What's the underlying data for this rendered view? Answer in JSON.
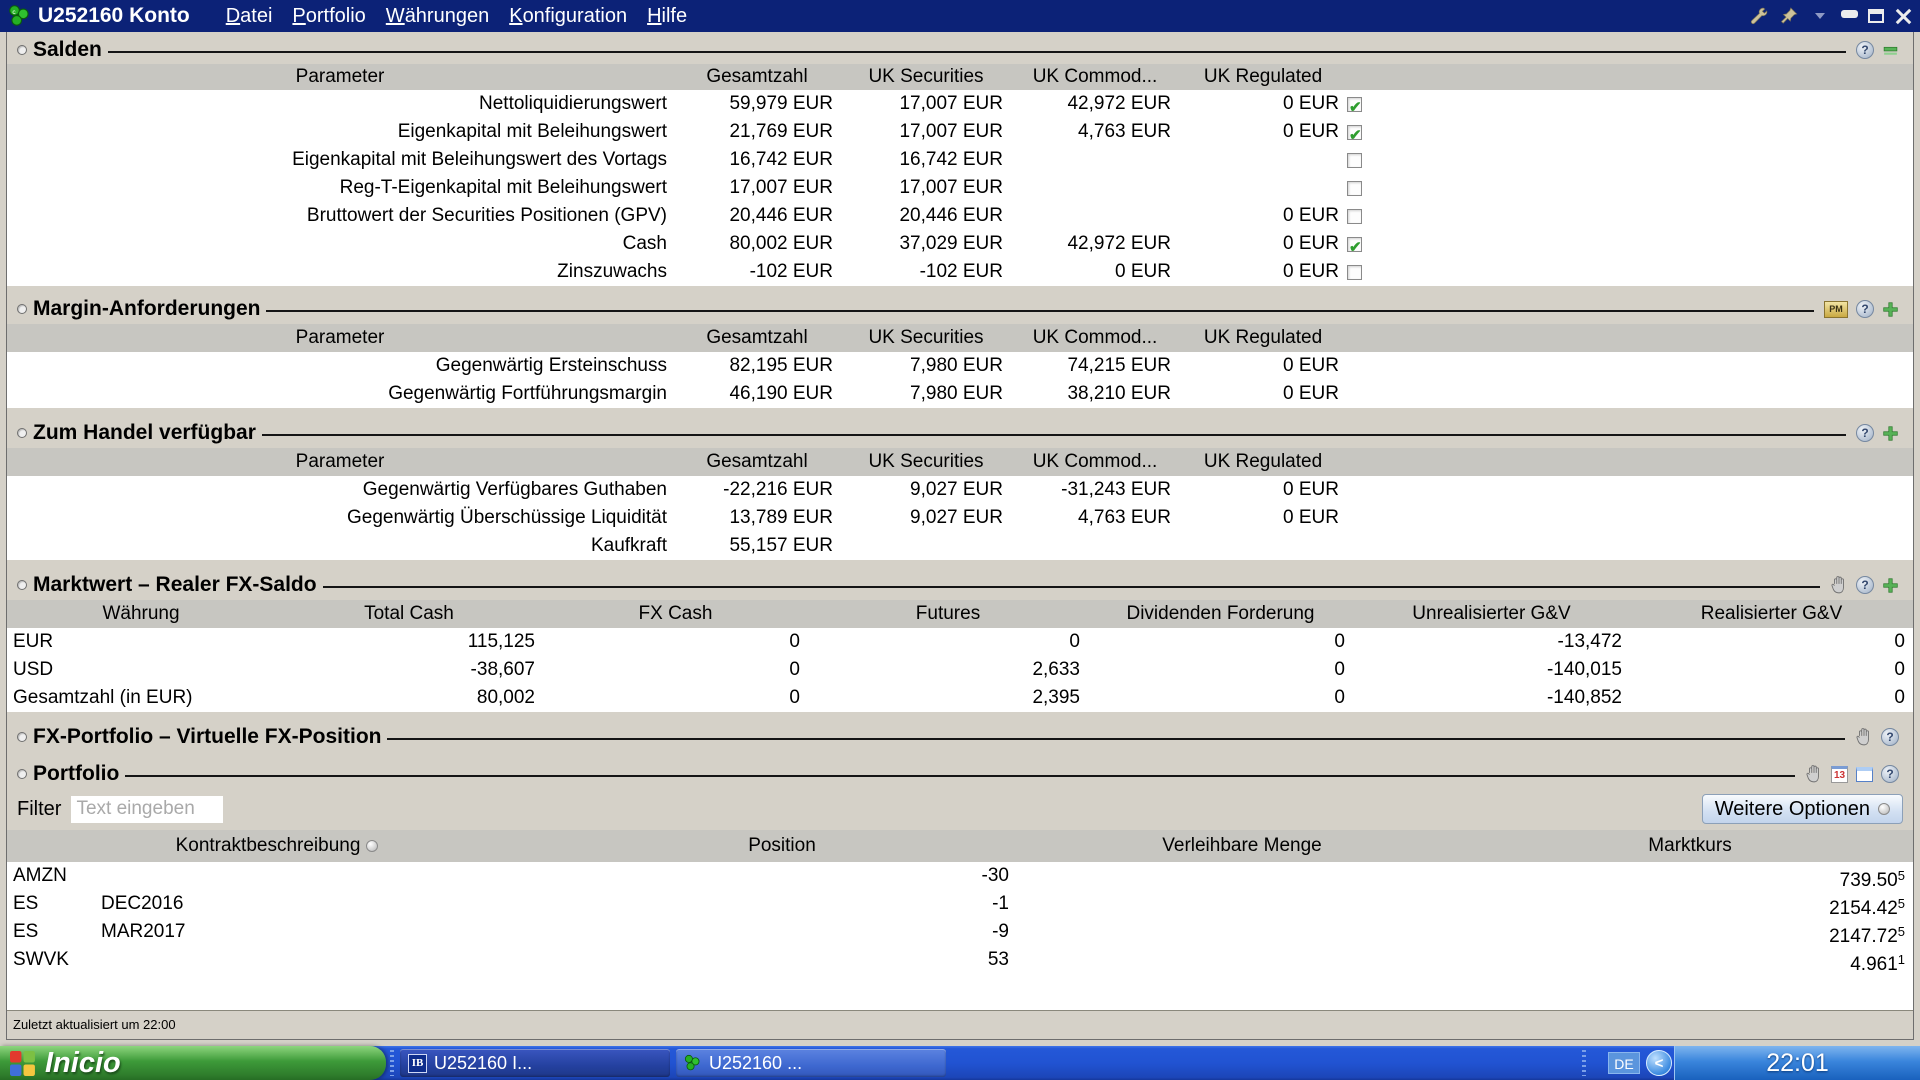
{
  "titlebar": {
    "title": "U252160 Konto",
    "menus": [
      {
        "label": "Datei"
      },
      {
        "label": "Portfolio"
      },
      {
        "label": "Währungen"
      },
      {
        "label": "Konfiguration"
      },
      {
        "label": "Hilfe"
      }
    ]
  },
  "balance_columns": {
    "parameter": "Parameter",
    "total": "Gesamtzahl",
    "uk_securities": "UK Securities",
    "uk_commodities": "UK Commod...",
    "uk_regulated": "UK Regulated"
  },
  "salden": {
    "title": "Salden",
    "rows": [
      {
        "label": "Nettoliquidierungswert",
        "total": "59,979 EUR",
        "uk_securities": "17,007 EUR",
        "uk_commodities": "42,972 EUR",
        "uk_regulated": "0 EUR",
        "checked": "true"
      },
      {
        "label": "Eigenkapital mit Beleihungswert",
        "total": "21,769 EUR",
        "uk_securities": "17,007 EUR",
        "uk_commodities": "4,763 EUR",
        "uk_regulated": "0 EUR",
        "checked": "true"
      },
      {
        "label": "Eigenkapital mit Beleihungswert des Vortags",
        "total": "16,742 EUR",
        "uk_securities": "16,742 EUR",
        "uk_commodities": "",
        "uk_regulated": "",
        "checked": "false"
      },
      {
        "label": "Reg-T-Eigenkapital mit Beleihungswert",
        "total": "17,007 EUR",
        "uk_securities": "17,007 EUR",
        "uk_commodities": "",
        "uk_regulated": "",
        "checked": "false"
      },
      {
        "label": "Bruttowert der Securities Positionen (GPV)",
        "total": "20,446 EUR",
        "uk_securities": "20,446 EUR",
        "uk_commodities": "",
        "uk_regulated": "0 EUR",
        "checked": "false"
      },
      {
        "label": "Cash",
        "total": "80,002 EUR",
        "uk_securities": "37,029 EUR",
        "uk_commodities": "42,972 EUR",
        "uk_regulated": "0 EUR",
        "checked": "true"
      },
      {
        "label": "Zinszuwachs",
        "total": "-102 EUR",
        "uk_securities": "-102 EUR",
        "uk_commodities": "0 EUR",
        "uk_regulated": "0 EUR",
        "checked": "false"
      }
    ]
  },
  "margin": {
    "title": "Margin-Anforderungen",
    "rows": [
      {
        "label": "Gegenwärtig Ersteinschuss",
        "total": "82,195 EUR",
        "uk_securities": "7,980 EUR",
        "uk_commodities": "74,215 EUR",
        "uk_regulated": "0 EUR"
      },
      {
        "label": "Gegenwärtig Fortführungsmargin",
        "total": "46,190 EUR",
        "uk_securities": "7,980 EUR",
        "uk_commodities": "38,210 EUR",
        "uk_regulated": "0 EUR"
      }
    ]
  },
  "available": {
    "title": "Zum Handel verfügbar",
    "rows": [
      {
        "label": "Gegenwärtig Verfügbares Guthaben",
        "total": "-22,216 EUR",
        "uk_securities": "9,027 EUR",
        "uk_commodities": "-31,243 EUR",
        "uk_regulated": "0 EUR"
      },
      {
        "label": "Gegenwärtig Überschüssige Liquidität",
        "total": "13,789 EUR",
        "uk_securities": "9,027 EUR",
        "uk_commodities": "4,763 EUR",
        "uk_regulated": "0 EUR"
      },
      {
        "label": "Kaufkraft",
        "total": "55,157 EUR",
        "uk_securities": "",
        "uk_commodities": "",
        "uk_regulated": ""
      }
    ]
  },
  "fx": {
    "title": "Marktwert – Realer FX-Saldo",
    "columns": {
      "currency": "Währung",
      "total_cash": "Total Cash",
      "fx_cash": "FX Cash",
      "futures": "Futures",
      "dividends": "Dividenden Forderung",
      "unrealized": "Unrealisierter G&V",
      "realized": "Realisierter G&V"
    },
    "rows": [
      {
        "currency": "EUR",
        "total_cash": "115,125",
        "fx_cash": "0",
        "futures": "0",
        "dividends": "0",
        "unrealized": "-13,472",
        "realized": "0"
      },
      {
        "currency": "USD",
        "total_cash": "-38,607",
        "fx_cash": "0",
        "futures": "2,633",
        "dividends": "0",
        "unrealized": "-140,015",
        "realized": "0"
      },
      {
        "currency": "Gesamtzahl (in EUR)",
        "total_cash": "80,002",
        "fx_cash": "0",
        "futures": "2,395",
        "dividends": "0",
        "unrealized": "-140,852",
        "realized": "0"
      }
    ]
  },
  "fx_portfolio": {
    "title": "FX-Portfolio – Virtuelle FX-Position"
  },
  "portfolio": {
    "title": "Portfolio",
    "filter_label": "Filter",
    "filter_placeholder": "Text eingeben",
    "more_options": "Weitere Optionen",
    "columns": {
      "description": "Kontraktbeschreibung",
      "position": "Position",
      "lendable": "Verleihbare Menge",
      "price": "Marktkurs"
    },
    "rows": [
      {
        "symbol": "AMZN",
        "expiry": "",
        "position": "-30",
        "lendable": "",
        "price": "739.50",
        "price_sup": "5"
      },
      {
        "symbol": "ES",
        "expiry": "DEC2016",
        "position": "-1",
        "lendable": "",
        "price": "2154.42",
        "price_sup": "5"
      },
      {
        "symbol": "ES",
        "expiry": "MAR2017",
        "position": "-9",
        "lendable": "",
        "price": "2147.72",
        "price_sup": "5"
      },
      {
        "symbol": "SWVK",
        "expiry": "",
        "position": "53",
        "lendable": "",
        "price": "4.961",
        "price_sup": "1"
      }
    ]
  },
  "statusbar": {
    "text": "Zuletzt aktualisiert um 22:00"
  },
  "taskbar": {
    "start": "Inicio",
    "tasks": [
      {
        "label": "U252160 I..."
      },
      {
        "label": "U252160 ..."
      }
    ],
    "tray": {
      "language": "DE",
      "clock": "22:01"
    }
  },
  "colors": {
    "titlebar": "#0c2277",
    "taskbar_blue": "#2153d2",
    "start_green": "#3d9a39",
    "check_green": "#2f9e2f"
  }
}
